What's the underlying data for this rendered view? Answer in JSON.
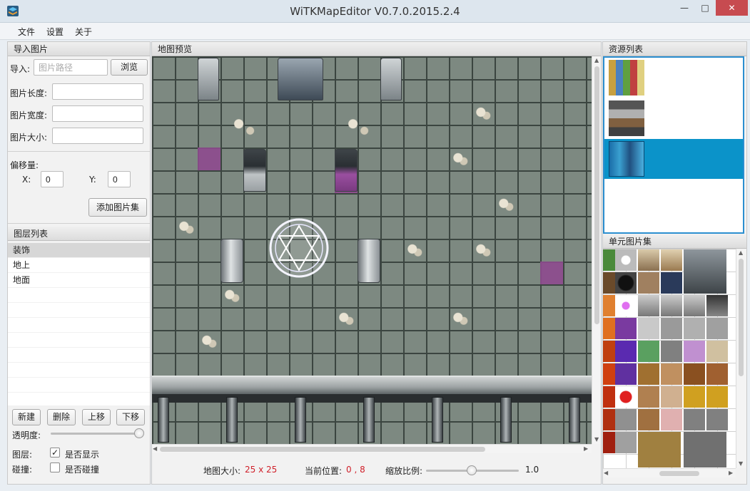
{
  "window": {
    "title": "WiTKMapEditor V0.7.0.2015.2.4",
    "minimize": "—",
    "maximize": "□",
    "close": "✕"
  },
  "menu": {
    "file": "文件",
    "settings": "设置",
    "about": "关于"
  },
  "import_panel": {
    "header": "导入图片",
    "import_label": "导入:",
    "path_placeholder": "图片路径",
    "browse": "浏览",
    "length_label": "图片长度:",
    "width_label": "图片宽度:",
    "size_label": "图片大小:",
    "offset_label": "偏移量:",
    "x_label": "X:",
    "x_value": "0",
    "y_label": "Y:",
    "y_value": "0",
    "add_set": "添加图片集"
  },
  "layer_panel": {
    "header": "图层列表",
    "items": [
      "装饰",
      "地上",
      "地面"
    ],
    "selected": "装饰",
    "new": "新建",
    "delete": "删除",
    "up": "上移",
    "down": "下移",
    "opacity_label": "透明度:",
    "opacity_value": 1.0,
    "layer_label": "图层:",
    "show_label": "是否显示",
    "show_checked": true,
    "collision_label": "碰撞:",
    "collide_label": "是否碰撞",
    "collide_checked": false
  },
  "map_panel": {
    "header": "地图预览",
    "size_label": "地图大小:",
    "size_value": "25 x 25",
    "pos_label": "当前位置:",
    "pos_value": "0 , 8",
    "zoom_label": "缩放比例:",
    "zoom_value": "1.0"
  },
  "resource_panel": {
    "header": "资源列表",
    "selected_index": 2
  },
  "tile_panel": {
    "header": "单元图片集"
  },
  "colors": {
    "accent": "#0b93c9",
    "status_value": "#d0202a",
    "highlight_tile": "#8e4a8e"
  }
}
